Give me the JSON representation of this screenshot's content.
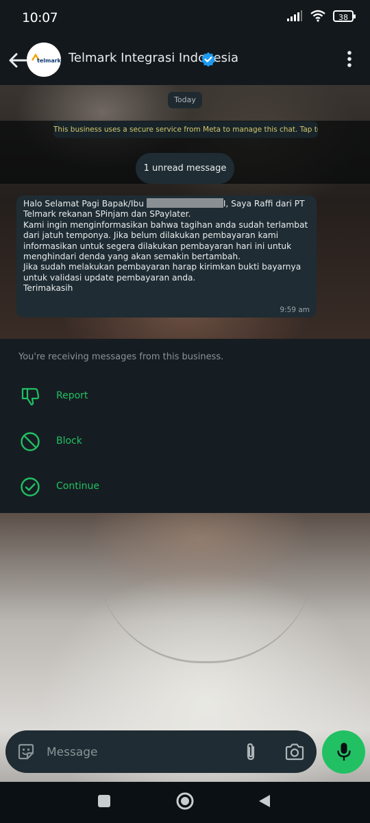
{
  "status_bar": {
    "time": "10:07",
    "battery": "38"
  },
  "header": {
    "title": "Telmark Integrasi Indonesia",
    "avatar_text": "telmark",
    "verified": true
  },
  "chat": {
    "date_chip": "Today",
    "system_notice": "This business uses a secure service from Meta to manage this chat. Tap to learn more.",
    "unread_chip": "1 unread message",
    "message": {
      "line1_before": "Halo Selamat Pagi Bapak/Ibu ",
      "line1_after": "I, Saya Raffi dari PT Telmark rekanan SPinjam dan SPaylater.",
      "body": "\nKami ingin menginformasikan bahwa tagihan anda sudah terlambat dari jatuh temponya. Jika belum dilakukan pembayaran kami informasikan untuk segera dilakukan pembayaran hari ini untuk menghindari denda yang akan semakin bertambah.\nJika sudah melakukan pembayaran harap kirimkan bukti bayarnya untuk validasi update pembayaran anda.\nTerimakasih",
      "time": "9:59 am"
    }
  },
  "action_sheet": {
    "caption": "You're receiving messages from this business.",
    "actions": [
      {
        "label": "Report",
        "icon": "thumbs-down-icon"
      },
      {
        "label": "Block",
        "icon": "block-icon"
      },
      {
        "label": "Continue",
        "icon": "check-circle-icon"
      }
    ]
  },
  "composer": {
    "placeholder": "Message"
  },
  "colors": {
    "accent": "#21c063",
    "bubble": "#1f2c33",
    "header": "#12181c"
  }
}
